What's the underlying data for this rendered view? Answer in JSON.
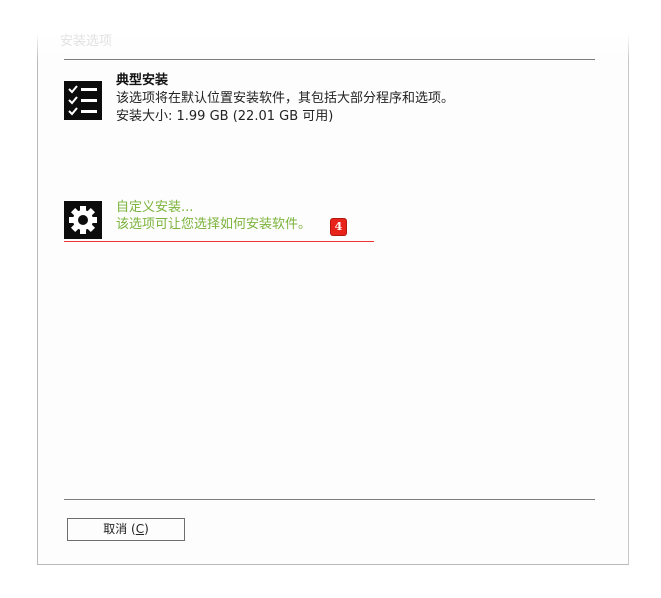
{
  "header": {
    "caption": "安装选项"
  },
  "options": {
    "typical": {
      "title": "典型安装",
      "description": "该选项将在默认位置安装软件，其包括大部分程序和选项。",
      "size_text": "安装大小: 1.99 GB (22.01 GB 可用)",
      "icon": "checklist-icon"
    },
    "custom": {
      "title": "自定义安装...",
      "description": "该选项可让您选择如何安装软件。",
      "icon": "gear-icon",
      "step_badge": "4"
    }
  },
  "footer": {
    "cancel_label": "取消 (",
    "cancel_accel": "C",
    "cancel_suffix": ")"
  },
  "colors": {
    "custom_text": "#7bb33a",
    "badge": "#e8231b",
    "underline": "#ee3333"
  }
}
